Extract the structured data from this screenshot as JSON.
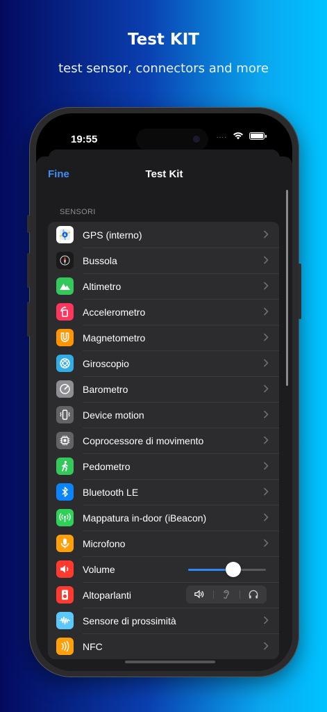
{
  "promo": {
    "title": "Test KIT",
    "subtitle": "test sensor, connectors and more"
  },
  "status_bar": {
    "time": "19:55",
    "signal": "....",
    "wifi_icon": "wifi-icon",
    "battery_icon": "battery-icon"
  },
  "nav": {
    "left_button": "Fine",
    "title": "Test Kit"
  },
  "section": {
    "header": "SENSORI"
  },
  "items": [
    {
      "label": "GPS (interno)",
      "icon": "maps-icon",
      "color": "#ffffff",
      "type": "chevron"
    },
    {
      "label": "Bussola",
      "icon": "compass-icon",
      "color": "#1a1a1a",
      "type": "chevron"
    },
    {
      "label": "Altimetro",
      "icon": "mountain-icon",
      "color": "#34c759",
      "type": "chevron"
    },
    {
      "label": "Accelerometro",
      "icon": "rotate-icon",
      "color": "#ff375f",
      "type": "chevron"
    },
    {
      "label": "Magnetometro",
      "icon": "magnet-icon",
      "color": "#ff9500",
      "type": "chevron"
    },
    {
      "label": "Giroscopio",
      "icon": "gyroscope-icon",
      "color": "#32ade6",
      "type": "chevron"
    },
    {
      "label": "Barometro",
      "icon": "gauge-icon",
      "color": "#8e8e93",
      "type": "chevron"
    },
    {
      "label": "Device motion",
      "icon": "phone-vibrate-icon",
      "color": "#636366",
      "type": "chevron"
    },
    {
      "label": "Coprocessore di movimento",
      "icon": "chip-icon",
      "color": "#636366",
      "type": "chevron"
    },
    {
      "label": "Pedometro",
      "icon": "walking-icon",
      "color": "#34c759",
      "type": "chevron"
    },
    {
      "label": "Bluetooth LE",
      "icon": "bluetooth-icon",
      "color": "#0a84ff",
      "type": "chevron"
    },
    {
      "label": "Mappatura in-door (iBeacon)",
      "icon": "antenna-icon",
      "color": "#30d158",
      "type": "chevron"
    },
    {
      "label": "Microfono",
      "icon": "microphone-icon",
      "color": "#ff9f0a",
      "type": "chevron"
    },
    {
      "label": "Volume",
      "icon": "speaker-icon",
      "color": "#ff3b30",
      "type": "slider",
      "value": 0.58
    },
    {
      "label": "Altoparlanti",
      "icon": "loudspeaker-icon",
      "color": "#ff3b30",
      "type": "segmented",
      "segments": [
        "speaker-wave-icon",
        "ear-icon",
        "headphones-icon"
      ]
    },
    {
      "label": "Sensore di prossimità",
      "icon": "waveform-icon",
      "color": "#5ac8fa",
      "type": "chevron"
    },
    {
      "label": "NFC",
      "icon": "nfc-icon",
      "color": "#ff9f0a",
      "type": "chevron"
    }
  ]
}
